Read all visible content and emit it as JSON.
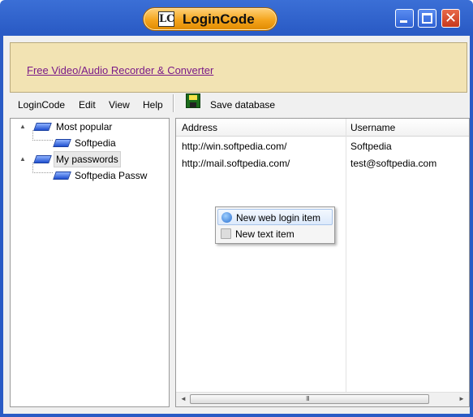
{
  "window": {
    "title": "LoginCode",
    "logo_glyph": "LC",
    "close_glyph": "✕"
  },
  "banner": {
    "link_text": "Free Video/Audio Recorder & Converter"
  },
  "menu": {
    "items": [
      "LoginCode",
      "Edit",
      "View",
      "Help"
    ],
    "save_label": "Save database"
  },
  "tree": {
    "nodes": [
      {
        "label": "Most popular",
        "level": 0,
        "expander": "▲"
      },
      {
        "label": "Softpedia",
        "level": 1
      },
      {
        "label": "My passwords",
        "level": 0,
        "expander": "▲",
        "selected": true
      },
      {
        "label": "Softpedia Passw",
        "level": 1
      }
    ]
  },
  "list": {
    "columns": [
      "Address",
      "Username"
    ],
    "rows": [
      {
        "address": "http://win.softpedia.com/",
        "username": "Softpedia"
      },
      {
        "address": "http://mail.softpedia.com/",
        "username": "test@softpedia.com"
      }
    ],
    "scroll_left": "◄",
    "scroll_right": "►",
    "scroll_grip": "III"
  },
  "context_menu": {
    "items": [
      {
        "label": "New web login item",
        "icon": "globe-add-icon",
        "highlighted": true
      },
      {
        "label": "New text item",
        "icon": "text-add-icon",
        "highlighted": false
      }
    ]
  },
  "colors": {
    "titlebar": "#2a5bc5",
    "title_pill": "#f4a41c",
    "banner_bg": "#f2e3b3",
    "link": "#7a1a88"
  }
}
